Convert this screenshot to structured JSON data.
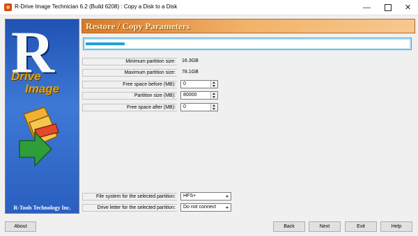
{
  "window": {
    "title": "R-Drive Image Technician 6.2 (Build 6208) : Copy a Disk to a Disk",
    "minimize_glyph": "—",
    "close_glyph": "✕"
  },
  "branding": {
    "letter": "R",
    "drive": "Drive",
    "image": "Image",
    "company": "R-Tools Technology Inc."
  },
  "header": {
    "title": "Restore / Copy Parameters",
    "color": "#d77a2a"
  },
  "progress": {
    "fill_fraction": 0.12
  },
  "params": {
    "min_size_label": "Minimum partition size:",
    "min_size_value": "16.3GB",
    "max_size_label": "Maximum partition size:",
    "max_size_value": "78.1GB",
    "free_before_label": "Free space before (MB):",
    "free_before_value": "0",
    "partition_size_label": "Partition size (MB):",
    "partition_size_value": "80000",
    "free_after_label": "Free space after (MB):",
    "free_after_value": "0"
  },
  "filesystem": {
    "label": "File system for the selected partition:",
    "value": "HFS+"
  },
  "drive_letter": {
    "label": "Drive letter for the selected partition:",
    "value": "Do not connect"
  },
  "buttons": {
    "about": "About",
    "back": "Back",
    "next": "Next",
    "exit": "Exit",
    "help": "Help"
  }
}
